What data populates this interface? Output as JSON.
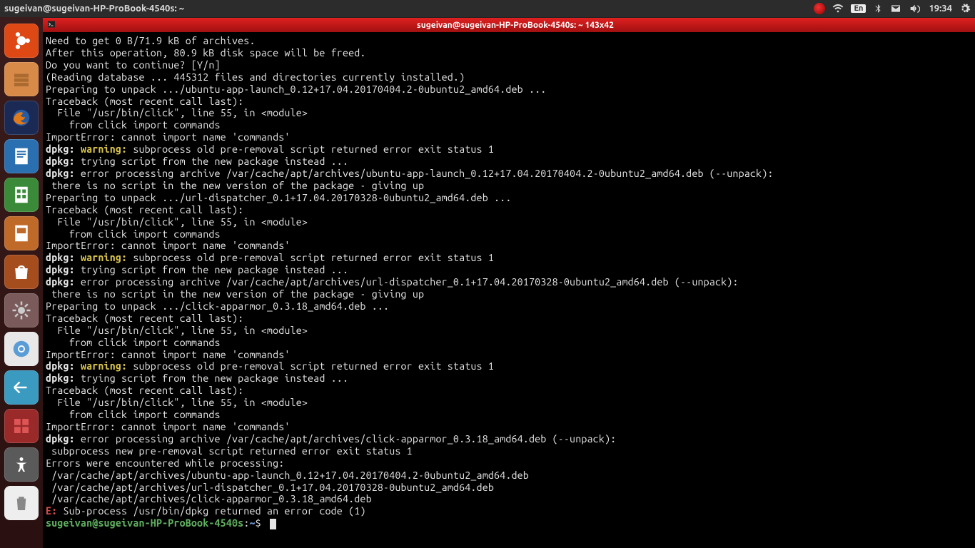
{
  "topbar": {
    "title": "sugeivan@sugeivan-HP-ProBook-4540s: ~",
    "lang": "En",
    "clock": "19:34"
  },
  "terminal": {
    "titlebar": "sugeivan@sugeivan-HP-ProBook-4540s: ~ 143x42",
    "prompt_user": "sugeivan@sugeivan-HP-ProBook-4540s",
    "prompt_sep": ":",
    "prompt_path": "~",
    "prompt_dollar": "$ ",
    "lines": [
      "Need to get 0 B/71.9 kB of archives.",
      "After this operation, 80.9 kB disk space will be freed.",
      "Do you want to continue? [Y/n]",
      "(Reading database ... 445312 files and directories currently installed.)",
      "Preparing to unpack .../ubuntu-app-launch_0.12+17.04.20170404.2-0ubuntu2_amd64.deb ...",
      "Traceback (most recent call last):",
      "  File \"/usr/bin/click\", line 55, in <module>",
      "    from click import commands",
      "ImportError: cannot import name 'commands'",
      "|DPKG_WARN| subprocess old pre-removal script returned error exit status 1",
      "|DPKG| trying script from the new package instead ...",
      "|DPKG| error processing archive /var/cache/apt/archives/ubuntu-app-launch_0.12+17.04.20170404.2-0ubuntu2_amd64.deb (--unpack):",
      " there is no script in the new version of the package - giving up",
      "Preparing to unpack .../url-dispatcher_0.1+17.04.20170328-0ubuntu2_amd64.deb ...",
      "Traceback (most recent call last):",
      "  File \"/usr/bin/click\", line 55, in <module>",
      "    from click import commands",
      "ImportError: cannot import name 'commands'",
      "|DPKG_WARN| subprocess old pre-removal script returned error exit status 1",
      "|DPKG| trying script from the new package instead ...",
      "|DPKG| error processing archive /var/cache/apt/archives/url-dispatcher_0.1+17.04.20170328-0ubuntu2_amd64.deb (--unpack):",
      " there is no script in the new version of the package - giving up",
      "Preparing to unpack .../click-apparmor_0.3.18_amd64.deb ...",
      "Traceback (most recent call last):",
      "  File \"/usr/bin/click\", line 55, in <module>",
      "    from click import commands",
      "ImportError: cannot import name 'commands'",
      "|DPKG_WARN| subprocess old pre-removal script returned error exit status 1",
      "|DPKG| trying script from the new package instead ...",
      "Traceback (most recent call last):",
      "  File \"/usr/bin/click\", line 55, in <module>",
      "    from click import commands",
      "ImportError: cannot import name 'commands'",
      "|DPKG| error processing archive /var/cache/apt/archives/click-apparmor_0.3.18_amd64.deb (--unpack):",
      " subprocess new pre-removal script returned error exit status 1",
      "Errors were encountered while processing:",
      " /var/cache/apt/archives/ubuntu-app-launch_0.12+17.04.20170404.2-0ubuntu2_amd64.deb",
      " /var/cache/apt/archives/url-dispatcher_0.1+17.04.20170328-0ubuntu2_amd64.deb",
      " /var/cache/apt/archives/click-apparmor_0.3.18_amd64.deb",
      "|ERED|E:|ENORM| Sub-process /usr/bin/dpkg returned an error code (1)"
    ],
    "dpkg_label": "dpkg:",
    "dpkg_warning": "warning:"
  },
  "launcher": {
    "items": [
      "ubuntu-dash",
      "files",
      "firefox",
      "writer",
      "calc",
      "impress",
      "software-store",
      "system-settings",
      "chromium",
      "screenshot",
      "ccsm",
      "accessibility",
      "trash"
    ]
  }
}
